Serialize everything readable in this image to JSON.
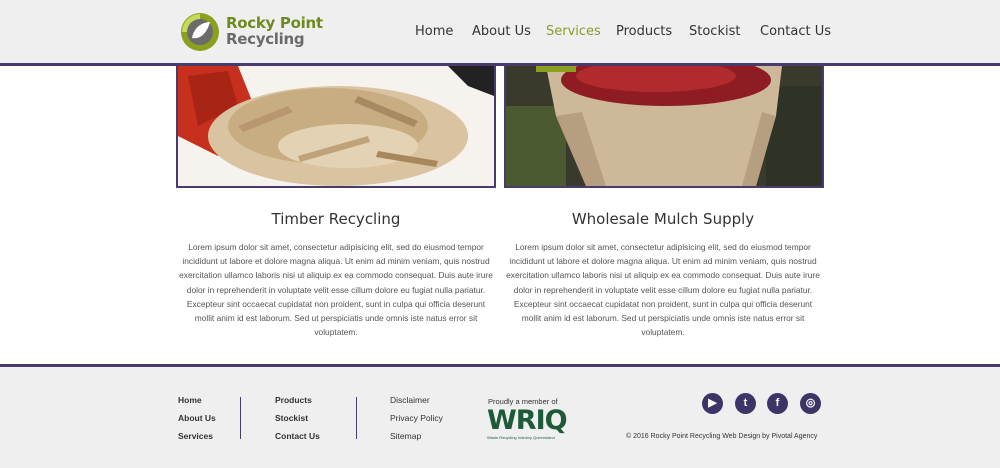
{
  "brand": {
    "line1": "Rocky Point",
    "line2": "Recycling"
  },
  "nav": [
    {
      "label": "Home",
      "active": false
    },
    {
      "label": "About Us",
      "active": false
    },
    {
      "label": "Services",
      "active": true
    },
    {
      "label": "Products",
      "active": false
    },
    {
      "label": "Stockist",
      "active": false
    },
    {
      "label": "Contact Us",
      "active": false
    }
  ],
  "services": [
    {
      "title": "Timber Recycling",
      "body": "Lorem ipsum dolor sit amet, consectetur adipisicing elit, sed do eiusmod tempor incididunt ut labore et dolore magna aliqua. Ut enim ad minim veniam, quis nostrud exercitation ullamco laboris nisi ut aliquip ex ea commodo consequat. Duis aute irure dolor in reprehenderit in voluptate velit esse cillum dolore eu fugiat nulla pariatur. Excepteur sint occaecat cupidatat non proident, sunt in culpa qui officia deserunt mollit anim id est laborum. Sed ut perspiciatis unde omnis iste natus error sit voluptatem."
    },
    {
      "title": "Wholesale Mulch Supply",
      "body": "Lorem ipsum dolor sit amet, consectetur adipisicing elit, sed do eiusmod tempor incididunt ut labore et dolore magna aliqua. Ut enim ad minim veniam, quis nostrud exercitation ullamco laboris nisi ut aliquip ex ea commodo consequat. Duis aute irure dolor in reprehenderit in voluptate velit esse cillum dolore eu fugiat nulla pariatur. Excepteur sint occaecat cupidatat non proident, sunt in culpa qui officia deserunt mollit anim id est laborum. Sed ut perspiciatis unde omnis iste natus error sit voluptatem."
    }
  ],
  "footer": {
    "col1": [
      "Home",
      "About Us",
      "Services"
    ],
    "col2": [
      "Products",
      "Stockist",
      "Contact Us"
    ],
    "col3": [
      "Disclaimer",
      "Privacy Policy",
      "Sitemap"
    ],
    "member_label": "Proudly a member of",
    "wriq_logo": "WRIQ",
    "wriq_sub": "Waste Recycling Industry Queensland",
    "social": [
      {
        "icon": "youtube-icon",
        "glyph": "▶"
      },
      {
        "icon": "twitter-icon",
        "glyph": "t"
      },
      {
        "icon": "facebook-icon",
        "glyph": "f"
      },
      {
        "icon": "instagram-icon",
        "glyph": "◎"
      }
    ],
    "copyright": "© 2016 Rocky Point Recycling Web Design by Pivotal Agency"
  },
  "colors": {
    "accent": "#4a3a6e",
    "active_nav": "#8a9c2a",
    "brand_green": "#6e8b1e"
  }
}
